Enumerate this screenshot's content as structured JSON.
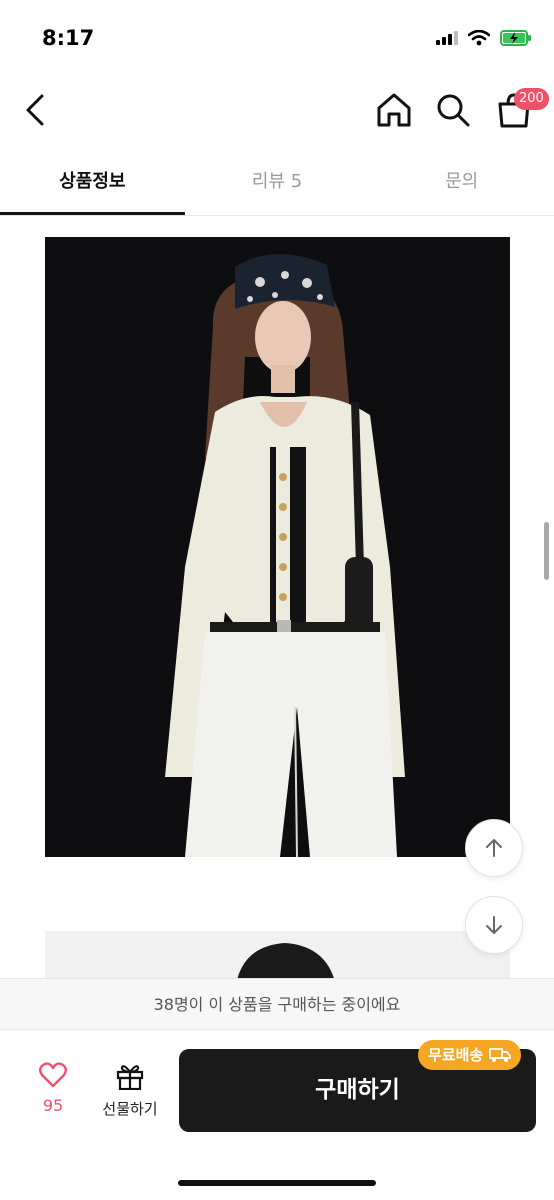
{
  "status_bar": {
    "time": "8:17"
  },
  "header": {
    "cart_badge": "200"
  },
  "tabs": [
    {
      "label": "상품정보"
    },
    {
      "label": "리뷰 5"
    },
    {
      "label": "문의"
    }
  ],
  "buyers_notice": "38명이 이 상품을 구매하는 중이에요",
  "bottom_bar": {
    "like_count": "95",
    "gift_label": "선물하기",
    "buy_label": "구매하기",
    "free_shipping_badge": "무료배송"
  },
  "colors": {
    "accent_pink": "#f0516a",
    "badge_orange": "#f5a623",
    "buy_button": "#1a1a1a"
  }
}
